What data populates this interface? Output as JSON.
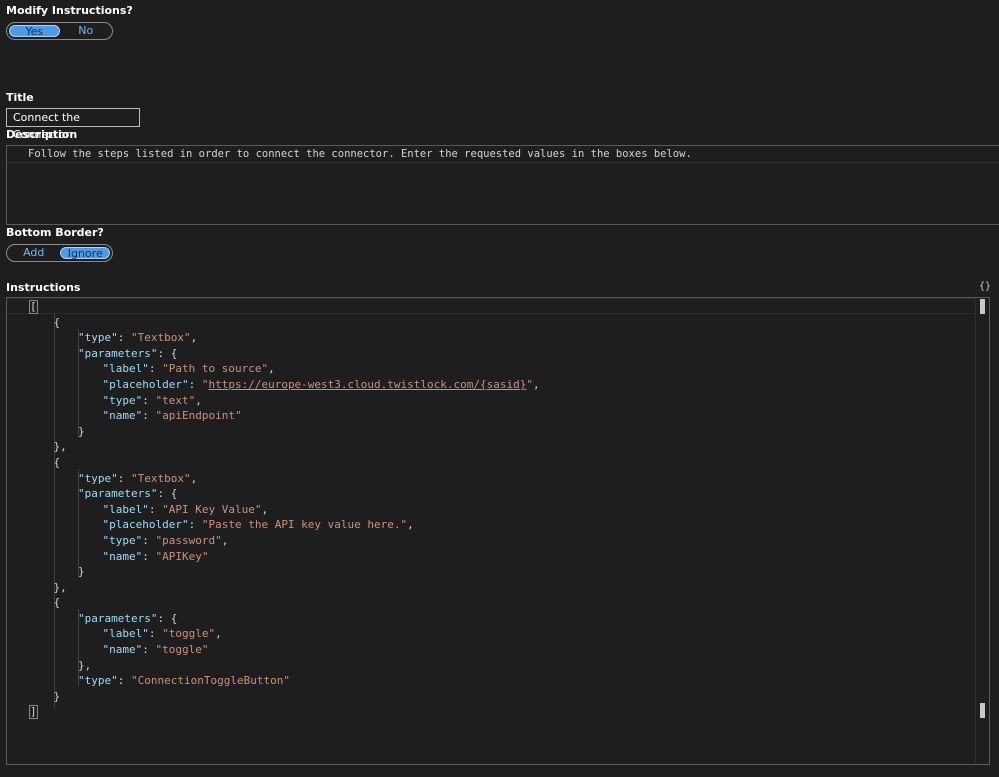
{
  "modify": {
    "label": "Modify Instructions?",
    "options": [
      {
        "label": "Yes",
        "selected": true
      },
      {
        "label": "No",
        "selected": false
      }
    ]
  },
  "title": {
    "label": "Title",
    "value": "Connect the Connector"
  },
  "description": {
    "label": "Description",
    "value": "Follow the steps listed in order to connect the connector. Enter the requested values in the boxes below."
  },
  "bottom_border": {
    "label": "Bottom Border?",
    "options": [
      {
        "label": "Add",
        "selected": false
      },
      {
        "label": "Ignore",
        "selected": true
      }
    ]
  },
  "instructions": {
    "label": "Instructions",
    "format_icon": "{}",
    "code_lines": [
      {
        "indent": 0,
        "tokens": [
          [
            "p",
            "["
          ]
        ]
      },
      {
        "indent": 1,
        "tokens": [
          [
            "p",
            "{"
          ]
        ]
      },
      {
        "indent": 2,
        "tokens": [
          [
            "k",
            "\"type\""
          ],
          [
            "p",
            ": "
          ],
          [
            "s",
            "\"Textbox\""
          ],
          [
            "p",
            ","
          ]
        ]
      },
      {
        "indent": 2,
        "tokens": [
          [
            "k",
            "\"parameters\""
          ],
          [
            "p",
            ": {"
          ]
        ]
      },
      {
        "indent": 3,
        "tokens": [
          [
            "k",
            "\"label\""
          ],
          [
            "p",
            ": "
          ],
          [
            "s",
            "\"Path to source\""
          ],
          [
            "p",
            ","
          ]
        ]
      },
      {
        "indent": 3,
        "tokens": [
          [
            "k",
            "\"placeholder\""
          ],
          [
            "p",
            ": "
          ],
          [
            "s",
            "\""
          ],
          [
            "sl",
            "https://europe-west3.cloud.twistlock.com/{sasid}"
          ],
          [
            "s",
            "\""
          ],
          [
            "p",
            ","
          ]
        ]
      },
      {
        "indent": 3,
        "tokens": [
          [
            "k",
            "\"type\""
          ],
          [
            "p",
            ": "
          ],
          [
            "s",
            "\"text\""
          ],
          [
            "p",
            ","
          ]
        ]
      },
      {
        "indent": 3,
        "tokens": [
          [
            "k",
            "\"name\""
          ],
          [
            "p",
            ": "
          ],
          [
            "s",
            "\"apiEndpoint\""
          ]
        ]
      },
      {
        "indent": 2,
        "tokens": [
          [
            "p",
            "}"
          ]
        ]
      },
      {
        "indent": 1,
        "tokens": [
          [
            "p",
            "},"
          ]
        ]
      },
      {
        "indent": 1,
        "tokens": [
          [
            "p",
            "{"
          ]
        ]
      },
      {
        "indent": 2,
        "tokens": [
          [
            "k",
            "\"type\""
          ],
          [
            "p",
            ": "
          ],
          [
            "s",
            "\"Textbox\""
          ],
          [
            "p",
            ","
          ]
        ]
      },
      {
        "indent": 2,
        "tokens": [
          [
            "k",
            "\"parameters\""
          ],
          [
            "p",
            ": {"
          ]
        ]
      },
      {
        "indent": 3,
        "tokens": [
          [
            "k",
            "\"label\""
          ],
          [
            "p",
            ": "
          ],
          [
            "s",
            "\"API Key Value\""
          ],
          [
            "p",
            ","
          ]
        ]
      },
      {
        "indent": 3,
        "tokens": [
          [
            "k",
            "\"placeholder\""
          ],
          [
            "p",
            ": "
          ],
          [
            "s",
            "\"Paste the API key value here.\""
          ],
          [
            "p",
            ","
          ]
        ]
      },
      {
        "indent": 3,
        "tokens": [
          [
            "k",
            "\"type\""
          ],
          [
            "p",
            ": "
          ],
          [
            "s",
            "\"password\""
          ],
          [
            "p",
            ","
          ]
        ]
      },
      {
        "indent": 3,
        "tokens": [
          [
            "k",
            "\"name\""
          ],
          [
            "p",
            ": "
          ],
          [
            "s",
            "\"APIKey\""
          ]
        ]
      },
      {
        "indent": 2,
        "tokens": [
          [
            "p",
            "}"
          ]
        ]
      },
      {
        "indent": 1,
        "tokens": [
          [
            "p",
            "},"
          ]
        ]
      },
      {
        "indent": 1,
        "tokens": [
          [
            "p",
            "{"
          ]
        ]
      },
      {
        "indent": 2,
        "tokens": [
          [
            "k",
            "\"parameters\""
          ],
          [
            "p",
            ": {"
          ]
        ]
      },
      {
        "indent": 3,
        "tokens": [
          [
            "k",
            "\"label\""
          ],
          [
            "p",
            ": "
          ],
          [
            "s",
            "\"toggle\""
          ],
          [
            "p",
            ","
          ]
        ]
      },
      {
        "indent": 3,
        "tokens": [
          [
            "k",
            "\"name\""
          ],
          [
            "p",
            ": "
          ],
          [
            "s",
            "\"toggle\""
          ]
        ]
      },
      {
        "indent": 2,
        "tokens": [
          [
            "p",
            "},"
          ]
        ]
      },
      {
        "indent": 2,
        "tokens": [
          [
            "k",
            "\"type\""
          ],
          [
            "p",
            ": "
          ],
          [
            "s",
            "\"ConnectionToggleButton\""
          ]
        ]
      },
      {
        "indent": 1,
        "tokens": [
          [
            "p",
            "}"
          ]
        ]
      },
      {
        "indent": 0,
        "tokens": [
          [
            "p",
            "]"
          ]
        ]
      }
    ]
  },
  "colors": {
    "background": "#1e1e1e",
    "accent": "#4c9be8",
    "json_key": "#9cdcfe",
    "json_string": "#ce9178"
  }
}
